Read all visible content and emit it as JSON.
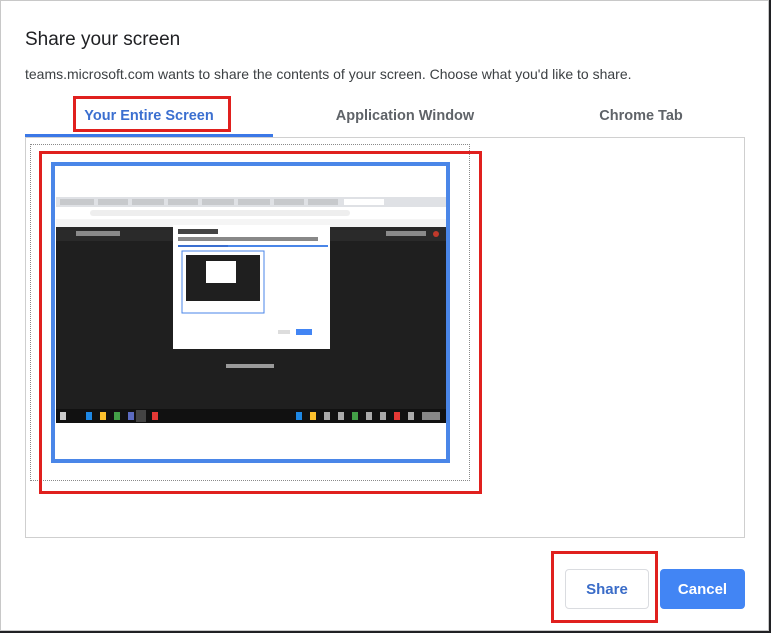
{
  "dialog": {
    "title": "Share your screen",
    "subtitle": "teams.microsoft.com wants to share the contents of your screen. Choose what you'd like to share."
  },
  "tabs": [
    {
      "label": "Your Entire Screen",
      "active": true
    },
    {
      "label": "Application Window",
      "active": false
    },
    {
      "label": "Chrome Tab",
      "active": false
    }
  ],
  "preview": {
    "selected": true,
    "kind": "entire-screen-thumbnail"
  },
  "buttons": {
    "share_label": "Share",
    "cancel_label": "Cancel"
  },
  "colors": {
    "accent": "#4285f4",
    "tab_active": "#3b6fd0",
    "highlight": "#e0201e",
    "selection": "#4a86e8"
  }
}
